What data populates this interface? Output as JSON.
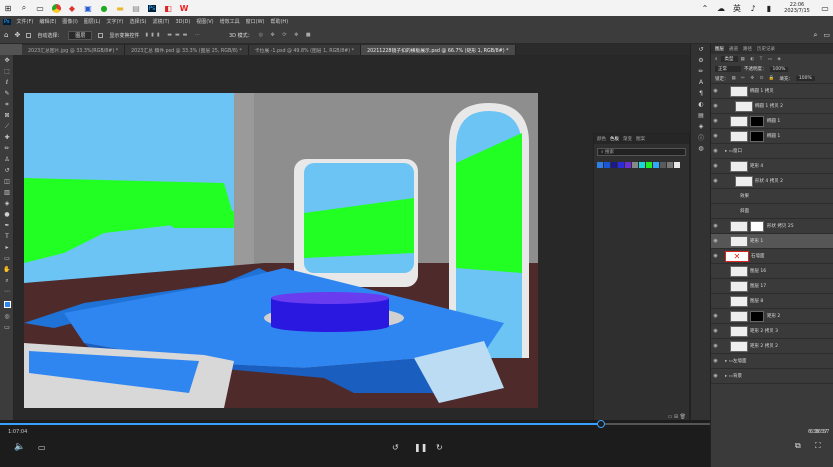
{
  "taskbar": {
    "icons": [
      "windows-logo",
      "search",
      "taskview",
      "chrome",
      "office",
      "app-blue",
      "chat",
      "file-manager",
      "notepad",
      "photoshop",
      "app-red",
      "wps"
    ],
    "time": "22:06",
    "date": "2023/7/15",
    "lang": "英",
    "tray": [
      "chevron",
      "cloud",
      "speaker",
      "battery"
    ]
  },
  "menu": [
    "文件(F)",
    "编辑(E)",
    "图像(I)",
    "图层(L)",
    "文字(Y)",
    "选择(S)",
    "滤镜(T)",
    "3D(D)",
    "视图(V)",
    "增效工具",
    "窗口(W)",
    "帮助(H)"
  ],
  "options": {
    "auto_select_label": "自动选择：",
    "auto_select_value": "图层",
    "show_transform": "显示变换控件",
    "mode_3d": "3D 模式："
  },
  "tabs": [
    {
      "label": "2023汇总图片.jpg @ 33.3%(RGB/8#) *",
      "active": false
    },
    {
      "label": "2023汇总 稿件.psd @ 33.3% (图层 25, RGB/8) *",
      "active": false
    },
    {
      "label": "卡拉展 -1.psd @ 49.8% (图层 1, RGB/8#) *",
      "active": false
    },
    {
      "label": "20211228镜子扣的横板展示.psd @ 66.7% (矩形 1, RGB/8#) *",
      "active": true
    }
  ],
  "swatches": {
    "tabs": [
      "颜色",
      "色板",
      "渐变",
      "图案"
    ],
    "search": "搜索",
    "colors": [
      "#2f7fe8",
      "#1a56d6",
      "#1a1a8c",
      "#2b2bd8",
      "#6b2fd8",
      "#888888",
      "#1ad8d8",
      "#22ee22",
      "#2fa8ff",
      "#5a5a5a",
      "#777777",
      "#e8e8e8"
    ]
  },
  "layers": {
    "tabs": [
      "图层",
      "通道",
      "路径",
      "历史记录"
    ],
    "kind": "类型",
    "blend": "正常",
    "opacity_label": "不透明度：",
    "opacity": "100%",
    "lock_label": "锁定：",
    "fill_label": "填充：",
    "fill": "100%",
    "rows": [
      {
        "name": "椭圆 1 拷贝",
        "indent": 2,
        "eye": true,
        "thumb": "#eee",
        "mask": null
      },
      {
        "name": "椭圆 1 拷贝 2",
        "indent": 3,
        "eye": true,
        "thumb": "#eee",
        "mask": null
      },
      {
        "name": "椭圆 1",
        "indent": 2,
        "eye": true,
        "thumb": "#eee",
        "mask": "#000"
      },
      {
        "name": "椭圆 1",
        "indent": 2,
        "eye": true,
        "thumb": "#eee",
        "mask": "#000"
      },
      {
        "name": "窗口",
        "indent": 1,
        "eye": true,
        "thumb": null,
        "mask": null,
        "folder": true
      },
      {
        "name": "矩形 4",
        "indent": 2,
        "eye": true,
        "thumb": "#eee",
        "mask": null
      },
      {
        "name": "形状 4 拷贝 2",
        "indent": 3,
        "eye": true,
        "thumb": "#eee",
        "mask": null
      },
      {
        "name": "效果",
        "indent": 4,
        "eye": false,
        "thumb": null,
        "mask": null
      },
      {
        "name": "斜面",
        "indent": 4,
        "eye": false,
        "thumb": null,
        "mask": null
      },
      {
        "name": "形状 拷贝 25",
        "indent": 2,
        "eye": true,
        "thumb": "#eee",
        "mask": "#fff"
      },
      {
        "name": "矩形 1",
        "indent": 2,
        "eye": true,
        "thumb": "#eee",
        "mask": null,
        "selected": true
      },
      {
        "name": "石墙面",
        "indent": 1,
        "eye": true,
        "thumb": "#fff",
        "mask": null,
        "red": true
      },
      {
        "name": "图层 16",
        "indent": 2,
        "eye": false,
        "thumb": "#eee",
        "mask": null
      },
      {
        "name": "图层 17",
        "indent": 2,
        "eye": false,
        "thumb": "#eee",
        "mask": null
      },
      {
        "name": "图层 8",
        "indent": 2,
        "eye": false,
        "thumb": "#eee",
        "mask": null
      },
      {
        "name": "矩形 2",
        "indent": 2,
        "eye": true,
        "thumb": "#eee",
        "mask": "#000"
      },
      {
        "name": "矩形 2 拷贝 3",
        "indent": 2,
        "eye": true,
        "thumb": "#eee",
        "mask": null
      },
      {
        "name": "矩形 2 拷贝 2",
        "indent": 2,
        "eye": true,
        "thumb": "#eee",
        "mask": null
      },
      {
        "name": "左墙面",
        "indent": 1,
        "eye": true,
        "thumb": null,
        "mask": null,
        "folder": true
      },
      {
        "name": "背景",
        "indent": 1,
        "eye": true,
        "thumb": null,
        "mask": null,
        "folder": true
      }
    ]
  },
  "video": {
    "current": "1:07:04",
    "duration": "6:36:57",
    "progress": 0.847
  },
  "colors": {
    "sky": "#6cc4f5",
    "grass": "#22ff22",
    "wall": "#8e8e8e",
    "floor": "#4e2a2a",
    "platform": "#2f86f0",
    "disc": "#2a18e0"
  }
}
